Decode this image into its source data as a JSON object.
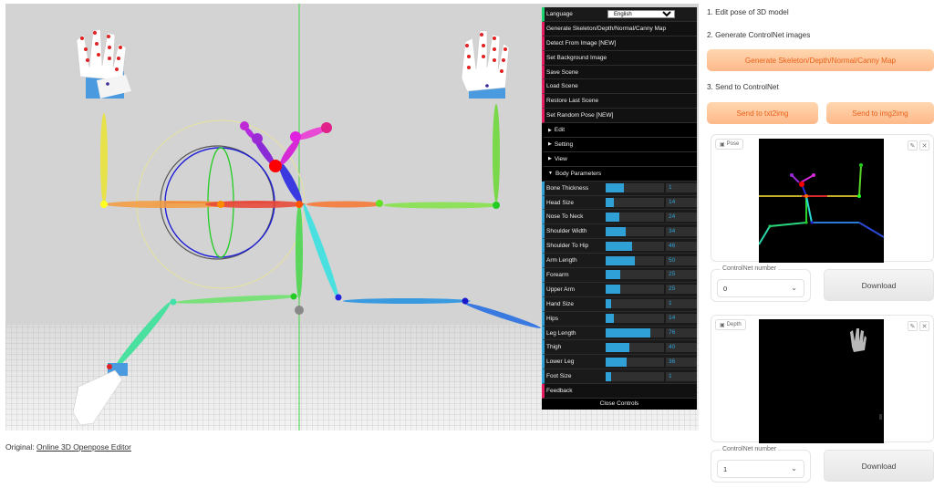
{
  "panel": {
    "language_label": "Language",
    "language_value": "English",
    "buttons": [
      "Generate Skeleton/Depth/Normal/Canny Map",
      "Detect From Image [NEW]",
      "Set Background Image",
      "Save Scene",
      "Load Scene",
      "Restore Last Scene",
      "Set Random Pose [NEW]"
    ],
    "folders": [
      "Edit",
      "Setting",
      "View"
    ],
    "body_params_label": "Body Parameters",
    "sliders": [
      {
        "label": "Bone Thickness",
        "value": "1",
        "fraction": 0.32
      },
      {
        "label": "Head Size",
        "value": "14",
        "fraction": 0.14
      },
      {
        "label": "Nose To Neck",
        "value": "24",
        "fraction": 0.24
      },
      {
        "label": "Shoulder Width",
        "value": "34",
        "fraction": 0.34
      },
      {
        "label": "Shoulder To Hip",
        "value": "46",
        "fraction": 0.46
      },
      {
        "label": "Arm Length",
        "value": "50",
        "fraction": 0.5
      },
      {
        "label": "Forearm",
        "value": "25",
        "fraction": 0.25
      },
      {
        "label": "Upper Arm",
        "value": "25",
        "fraction": 0.25
      },
      {
        "label": "Hand Size",
        "value": "1",
        "fraction": 0.1
      },
      {
        "label": "Hips",
        "value": "14",
        "fraction": 0.14
      },
      {
        "label": "Leg Length",
        "value": "76",
        "fraction": 0.76
      },
      {
        "label": "Thigh",
        "value": "40",
        "fraction": 0.4
      },
      {
        "label": "Lower Leg",
        "value": "36",
        "fraction": 0.36
      },
      {
        "label": "Foot Size",
        "value": "1",
        "fraction": 0.1
      }
    ],
    "feedback_label": "Feedback",
    "close_label": "Close Controls"
  },
  "original": {
    "prefix": "Original:",
    "link_text": "Online 3D Openpose Editor"
  },
  "right": {
    "step1": "1. Edit pose of 3D model",
    "step2": "2. Generate ControlNet images",
    "generate_btn": "Generate Skeleton/Depth/Normal/Canny Map",
    "step3": "3. Send to ControlNet",
    "send_txt2img": "Send to txt2img",
    "send_img2img": "Send to img2img",
    "pose_tag": "Pose",
    "depth_tag": "Depth",
    "controlnet_label": "ControlNet number",
    "cn1_value": "0",
    "cn2_value": "1",
    "download_label": "Download"
  },
  "colors": {
    "accent_orange": "#fdb98a",
    "panel_bg": "#1a1a1a",
    "slider_blue": "#2fa1d6"
  }
}
